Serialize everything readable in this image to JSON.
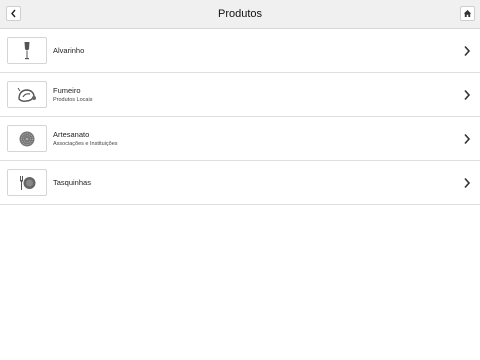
{
  "header": {
    "title": "Produtos",
    "back_icon": "chevron-left-icon",
    "home_icon": "home-icon"
  },
  "products": [
    {
      "name": "Alvarinho",
      "subtitle": "",
      "icon": "wine-glass-icon"
    },
    {
      "name": "Fumeiro",
      "subtitle": "Produtos Locais",
      "icon": "sausage-icon"
    },
    {
      "name": "Artesanato",
      "subtitle": "Associações e Instituições",
      "icon": "embroidery-icon"
    },
    {
      "name": "Tasquinhas",
      "subtitle": "",
      "icon": "plate-cutlery-icon"
    }
  ],
  "row_icon": "chevron-right-icon"
}
